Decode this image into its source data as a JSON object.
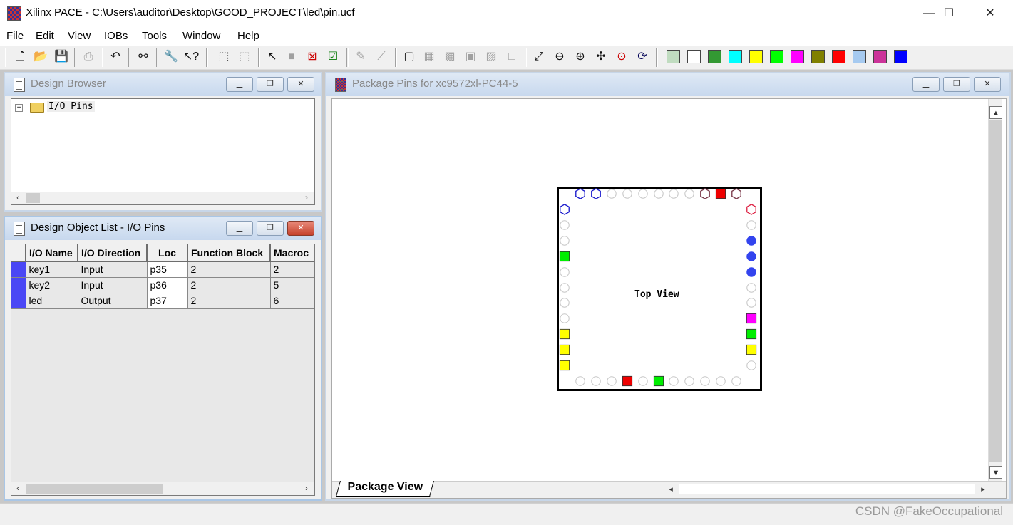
{
  "window": {
    "title": "Xilinx PACE - C:\\Users\\auditor\\Desktop\\GOOD_PROJECT\\led\\pin.ucf",
    "minimize": "—",
    "maximize": "☐",
    "close": "✕"
  },
  "menu": [
    "File",
    "Edit",
    "View",
    "IOBs",
    "Tools",
    "Window",
    "Help"
  ],
  "toolbar": {
    "icons": [
      "new-file-icon",
      "open-folder-icon",
      "save-icon",
      "print-icon",
      "undo-icon",
      "find-icon",
      "wrench-icon",
      "whats-this-icon",
      "select-area-icon",
      "select-area-dashed-icon",
      "pointer-icon",
      "filled-square-icon",
      "delete-box-icon",
      "checked-box-icon",
      "abc-tool-icon",
      "slope-tool-icon",
      "view-mode-1-icon",
      "view-mode-2-icon",
      "view-mode-3-icon",
      "view-mode-4-icon",
      "view-mode-5-icon",
      "view-mode-6-icon",
      "zoom-fit-icon",
      "zoom-out-icon",
      "zoom-in-icon",
      "zoom-full-icon",
      "zoom-select-icon",
      "refresh-icon"
    ],
    "swatches": [
      "#c0dcc0",
      "#ffffff",
      "#339933",
      "#00ffff",
      "#ffff00",
      "#00ff00",
      "#ff00ff",
      "#808000",
      "#ff0000",
      "#a6caf0",
      "#cc3399",
      "#0000ff"
    ]
  },
  "design_browser": {
    "title": "Design Browser",
    "tree_root": "I/O Pins",
    "expander": "+"
  },
  "object_list": {
    "title": "Design Object List - I/O Pins",
    "columns": [
      "I/O Name",
      "I/O Direction",
      "Loc",
      "Function Block",
      "Macroc"
    ],
    "rows": [
      {
        "name": "key1",
        "direction": "Input",
        "loc": "p35",
        "fb": "2",
        "mc": "2"
      },
      {
        "name": "key2",
        "direction": "Input",
        "loc": "p36",
        "fb": "2",
        "mc": "5"
      },
      {
        "name": "led",
        "direction": "Output",
        "loc": "p37",
        "fb": "2",
        "mc": "6"
      }
    ]
  },
  "package": {
    "title": "Package Pins for xc9572xl-PC44-5",
    "center_label": "Top View",
    "tab": "Package View",
    "pins": {
      "top": [
        {
          "shape": "hex",
          "color": "#1a1acc"
        },
        {
          "shape": "hex",
          "color": "#1a1acc"
        },
        {
          "shape": "circle",
          "color": "#c8c8c8"
        },
        {
          "shape": "circle",
          "color": "#c8c8c8"
        },
        {
          "shape": "circle",
          "color": "#c8c8c8"
        },
        {
          "shape": "circle",
          "color": "#c8c8c8"
        },
        {
          "shape": "circle",
          "color": "#c8c8c8"
        },
        {
          "shape": "circle",
          "color": "#c8c8c8"
        },
        {
          "shape": "hex",
          "color": "#7a3a4a"
        },
        {
          "shape": "square",
          "color": "#ee0000"
        },
        {
          "shape": "hex",
          "color": "#7a3a4a"
        }
      ],
      "left": [
        {
          "shape": "hex",
          "color": "#1a1acc"
        },
        {
          "shape": "circle",
          "color": "#c8c8c8"
        },
        {
          "shape": "circle",
          "color": "#c8c8c8"
        },
        {
          "shape": "square",
          "color": "#00ee00"
        },
        {
          "shape": "circle",
          "color": "#c8c8c8"
        },
        {
          "shape": "circle",
          "color": "#c8c8c8"
        },
        {
          "shape": "circle",
          "color": "#c8c8c8"
        },
        {
          "shape": "circle",
          "color": "#c8c8c8"
        },
        {
          "shape": "square",
          "color": "#ffff00"
        },
        {
          "shape": "square",
          "color": "#ffff00"
        },
        {
          "shape": "square",
          "color": "#ffff00"
        }
      ],
      "right": [
        {
          "shape": "hex",
          "color": "#dd2244"
        },
        {
          "shape": "circle",
          "color": "#c8c8c8"
        },
        {
          "shape": "dot",
          "color": "#3344ee"
        },
        {
          "shape": "dot",
          "color": "#3344ee"
        },
        {
          "shape": "dot",
          "color": "#3344ee"
        },
        {
          "shape": "circle",
          "color": "#c8c8c8"
        },
        {
          "shape": "circle",
          "color": "#c8c8c8"
        },
        {
          "shape": "square",
          "color": "#ff00ff"
        },
        {
          "shape": "square",
          "color": "#00ee00"
        },
        {
          "shape": "square",
          "color": "#ffff00"
        },
        {
          "shape": "circle",
          "color": "#c8c8c8"
        }
      ],
      "bottom": [
        {
          "shape": "circle",
          "color": "#c8c8c8"
        },
        {
          "shape": "circle",
          "color": "#c8c8c8"
        },
        {
          "shape": "circle",
          "color": "#c8c8c8"
        },
        {
          "shape": "square",
          "color": "#ee0000"
        },
        {
          "shape": "circle",
          "color": "#c8c8c8"
        },
        {
          "shape": "square",
          "color": "#00ee00"
        },
        {
          "shape": "circle",
          "color": "#c8c8c8"
        },
        {
          "shape": "circle",
          "color": "#c8c8c8"
        },
        {
          "shape": "circle",
          "color": "#c8c8c8"
        },
        {
          "shape": "circle",
          "color": "#c8c8c8"
        },
        {
          "shape": "circle",
          "color": "#c8c8c8"
        }
      ]
    }
  },
  "watermark": "CSDN @FakeOccupational"
}
